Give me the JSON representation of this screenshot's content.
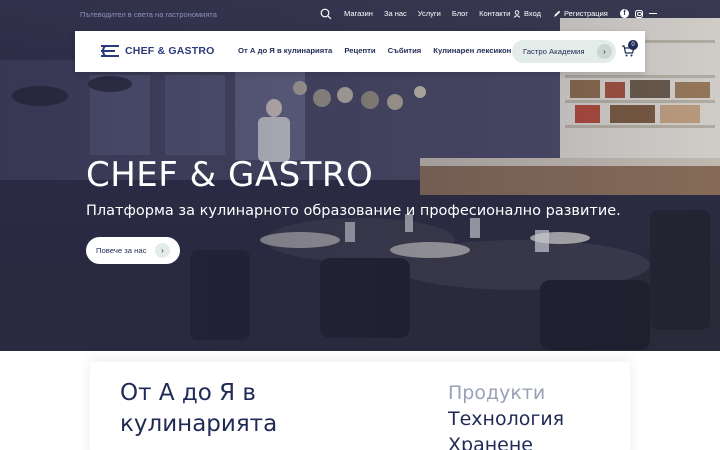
{
  "topbar": {
    "tagline": "Пътеводител в света на гастрономията",
    "links": [
      "Магазин",
      "За нас",
      "Услуги",
      "Блог",
      "Контакти"
    ],
    "login": "Вход",
    "register": "Регистрация"
  },
  "nav": {
    "logo_text": "CHEF & GASTRO",
    "items": [
      "От А до Я в кулинарията",
      "Рецепти",
      "Събития",
      "Кулинарен лексикон"
    ],
    "academy_label": "Гастро Академия",
    "cart_count": "0"
  },
  "hero": {
    "title": "CHEF & GASTRO",
    "subtitle": "Платформа за кулинарното образование и професионално развитие.",
    "button_label": "Повече за нас"
  },
  "section": {
    "heading_line1": "От А до Я в",
    "heading_line2": "кулинарията",
    "categories": [
      "Продукти",
      "Технология",
      "Хранене"
    ]
  },
  "colors": {
    "brand": "#1f2a55",
    "accent_soft": "#e4ece9"
  }
}
